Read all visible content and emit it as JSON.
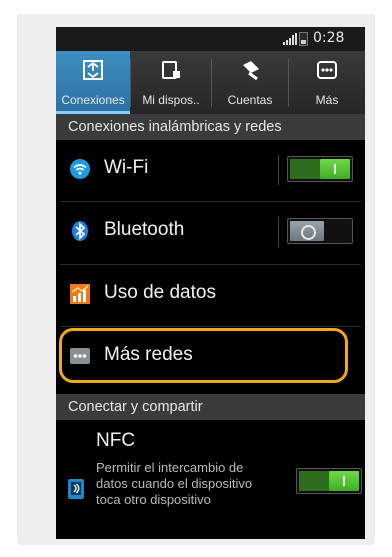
{
  "status_bar": {
    "time": "0:28"
  },
  "tabs": [
    {
      "label": "Conexiones",
      "icon": "connections-icon",
      "active": true
    },
    {
      "label": "Mi dispos..",
      "icon": "my-device-icon",
      "active": false
    },
    {
      "label": "Cuentas",
      "icon": "accounts-icon",
      "active": false
    },
    {
      "label": "Más",
      "icon": "more-icon",
      "active": false
    }
  ],
  "sections": {
    "wireless": "Conexiones inalámbricas y redes",
    "connect_share": "Conectar y compartir"
  },
  "items": {
    "wifi": {
      "label": "Wi-Fi",
      "icon": "wifi-icon",
      "toggle": "on"
    },
    "bluetooth": {
      "label": "Bluetooth",
      "icon": "bluetooth-icon",
      "toggle": "off"
    },
    "data_usage": {
      "label": "Uso de datos",
      "icon": "data-usage-icon"
    },
    "more_networks": {
      "label": "Más redes",
      "icon": "more-networks-icon"
    },
    "nfc": {
      "label": "NFC",
      "description": "Permitir el intercambio de datos cuando el dispositivo toca otro dispositivo",
      "icon": "nfc-icon",
      "toggle": "on"
    }
  },
  "colors": {
    "active_tab": "#2c6fa3",
    "toggle_on": "#3fae22",
    "highlight": "#f0a81f",
    "section_bg": "#3b3b3b"
  }
}
